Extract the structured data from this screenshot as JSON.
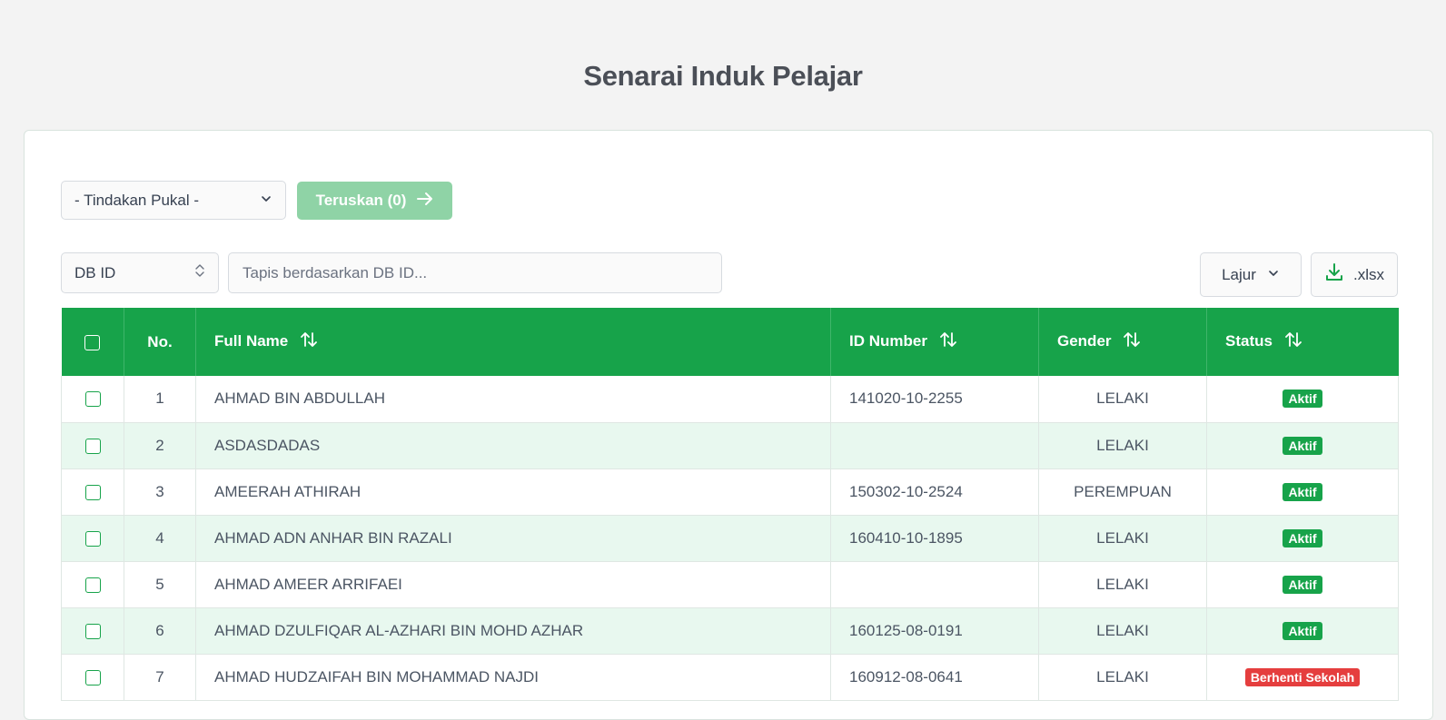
{
  "page": {
    "title": "Senarai Induk Pelajar"
  },
  "toolbar": {
    "bulk_action_value": "- Tindakan Pukal -",
    "proceed_label": "Teruskan (0)",
    "field_select_value": "DB ID",
    "filter_placeholder": "Tapis berdasarkan DB ID...",
    "columns_label": "Lajur",
    "export_label": ".xlsx"
  },
  "table": {
    "headers": {
      "no": "No.",
      "full_name": "Full Name",
      "id_number": "ID Number",
      "gender": "Gender",
      "status": "Status"
    },
    "rows": [
      {
        "no": "1",
        "full_name": "AHMAD BIN ABDULLAH",
        "id_number": "141020-10-2255",
        "gender": "LELAKI",
        "status": "Aktif",
        "status_color": "#17a34a"
      },
      {
        "no": "2",
        "full_name": "ASDASDADAS",
        "id_number": "",
        "gender": "LELAKI",
        "status": "Aktif",
        "status_color": "#17a34a"
      },
      {
        "no": "3",
        "full_name": "AMEERAH ATHIRAH",
        "id_number": "150302-10-2524",
        "gender": "PEREMPUAN",
        "status": "Aktif",
        "status_color": "#17a34a"
      },
      {
        "no": "4",
        "full_name": "AHMAD ADN ANHAR BIN RAZALI",
        "id_number": "160410-10-1895",
        "gender": "LELAKI",
        "status": "Aktif",
        "status_color": "#17a34a"
      },
      {
        "no": "5",
        "full_name": "AHMAD AMEER ARRIFAEI",
        "id_number": "",
        "gender": "LELAKI",
        "status": "Aktif",
        "status_color": "#17a34a"
      },
      {
        "no": "6",
        "full_name": "AHMAD DZULFIQAR AL-AZHARI BIN MOHD AZHAR",
        "id_number": "160125-08-0191",
        "gender": "LELAKI",
        "status": "Aktif",
        "status_color": "#17a34a"
      },
      {
        "no": "7",
        "full_name": "AHMAD HUDZAIFAH BIN MOHAMMAD NAJDI",
        "id_number": "160912-08-0641",
        "gender": "LELAKI",
        "status": "Berhenti Sekolah",
        "status_color": "#e53e3e"
      }
    ]
  },
  "icons": {
    "chevron": "chevron-down-icon",
    "arrow": "arrow-right-icon",
    "sort": "sort-arrows-icon",
    "download": "download-icon",
    "select_updown": "chevron-up-down-icon"
  },
  "colors": {
    "primary": "#17a34a",
    "row_alt": "#e8f8ef",
    "danger": "#e53e3e"
  }
}
